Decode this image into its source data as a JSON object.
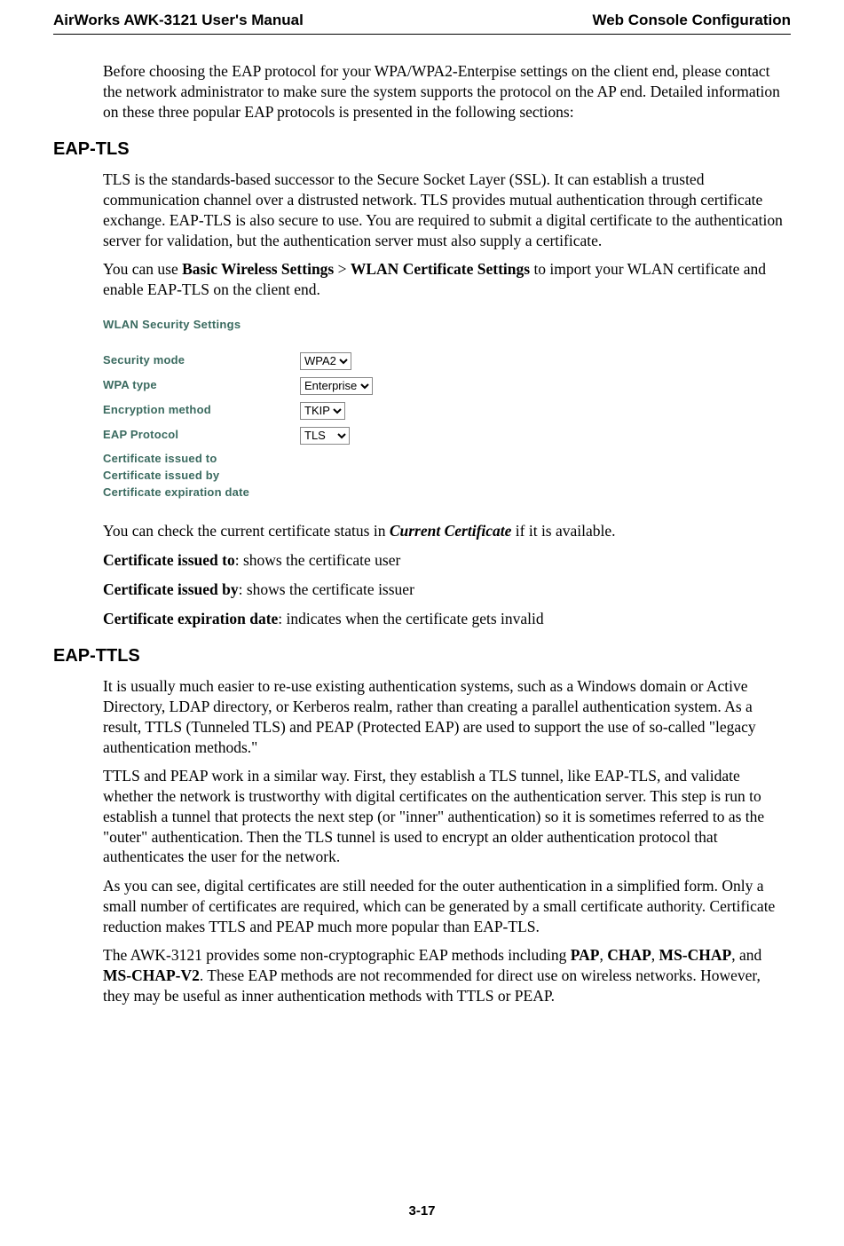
{
  "header": {
    "left": "AirWorks AWK-3121 User's Manual",
    "right": "Web Console Configuration"
  },
  "intro_p": "Before choosing the EAP protocol for your WPA/WPA2-Enterpise settings on the client end, please contact the network administrator to make sure the system supports the protocol on the AP end. Detailed information on these three popular EAP protocols is presented in the following sections:",
  "eap_tls": {
    "heading": "EAP-TLS",
    "p1": "TLS is the standards-based successor to the Secure Socket Layer (SSL). It can establish a trusted communication channel over a distrusted network. TLS provides mutual authentication through certificate exchange. EAP-TLS is also secure to use. You are required to submit a digital certificate to the authentication server for validation, but the authentication server must also supply a certificate.",
    "p2_a": "You can use ",
    "p2_b1": "Basic Wireless Settings",
    "p2_gt": " > ",
    "p2_b2": "WLAN Certificate Settings",
    "p2_c": " to import your WLAN certificate and enable EAP-TLS on the client end.",
    "p3_a": "You can check the current certificate status in ",
    "p3_em": "Current Certificate",
    "p3_b": " if it is available.",
    "c1_b": "Certificate issued to",
    "c1_t": ": shows the certificate user",
    "c2_b": "Certificate issued by",
    "c2_t": ": shows the certificate issuer",
    "c3_b": "Certificate expiration date",
    "c3_t": ": indicates when the certificate gets invalid"
  },
  "screenshot": {
    "title": "WLAN Security Settings",
    "rows": {
      "security_mode": {
        "label": "Security mode",
        "value": "WPA2"
      },
      "wpa_type": {
        "label": "WPA type",
        "value": "Enterprise"
      },
      "encryption": {
        "label": "Encryption method",
        "value": "TKIP"
      },
      "eap_protocol": {
        "label": "EAP Protocol",
        "value": "TLS"
      },
      "cert_to": {
        "label": "Certificate issued to"
      },
      "cert_by": {
        "label": "Certificate issued by"
      },
      "cert_exp": {
        "label": "Certificate expiration date"
      }
    }
  },
  "eap_ttls": {
    "heading": "EAP-TTLS",
    "p1": "It is usually much easier to re-use existing authentication systems, such as a Windows domain or Active Directory, LDAP directory, or Kerberos realm, rather than creating a parallel authentication system. As a result, TTLS (Tunneled TLS) and PEAP (Protected EAP) are used to support the use of so-called \"legacy authentication methods.\"",
    "p2": "TTLS and PEAP work in a similar way. First, they establish a TLS tunnel, like EAP-TLS, and validate whether the network is trustworthy with digital certificates on the authentication server. This step is run to establish a tunnel that protects the next step (or \"inner\" authentication) so it is sometimes referred to as the \"outer\" authentication. Then the TLS tunnel is used to encrypt an older authentication protocol that authenticates the user for the network.",
    "p3": "As you can see, digital certificates are still needed for the outer authentication in a simplified form. Only a small number of certificates are required, which can be generated by a small certificate authority. Certificate reduction makes TTLS and PEAP much more popular than EAP-TLS.",
    "p4_a": "The AWK-3121 provides some non-cryptographic EAP methods including ",
    "p4_b1": "PAP",
    "p4_s1": ", ",
    "p4_b2": "CHAP",
    "p4_s2": ", ",
    "p4_b3": "MS-CHAP",
    "p4_s3": ", and ",
    "p4_b4": "MS-CHAP-V2",
    "p4_c": ". These EAP methods are not recommended for direct use on wireless networks. However, they may be useful as inner authentication methods with TTLS or PEAP."
  },
  "footer": "3-17"
}
